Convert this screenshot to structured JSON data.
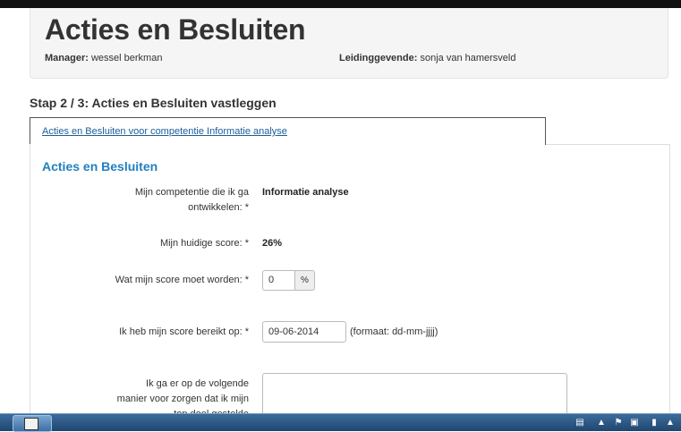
{
  "header": {
    "title": "Acties en Besluiten",
    "manager_label": "Manager:",
    "manager_value": "wessel berkman",
    "leidinggevende_label": "Leidinggevende:",
    "leidinggevende_value": "sonja van hamersveld"
  },
  "step_title": "Stap 2 / 3: Acties en Besluiten vastleggen",
  "tab": {
    "label": "Acties en Besluiten voor competentie Informatie analyse"
  },
  "section_title": "Acties en Besluiten",
  "form": {
    "competentie_label": "Mijn competentie die ik ga ontwikkelen: *",
    "competentie_value": "Informatie analyse",
    "huidige_label": "Mijn huidige score: *",
    "huidige_value": "26%",
    "doel_label": "Wat mijn score moet worden: *",
    "doel_value": "0",
    "doel_addon": "%",
    "datum_label": "Ik heb mijn score bereikt op: *",
    "datum_value": "09-06-2014",
    "datum_hint": "(formaat: dd-mm-jjjj)",
    "manier_label": "Ik ga er op de volgende manier voor zorgen dat ik mijn top doel gestelde"
  },
  "colors": {
    "accent": "#1f7fbf",
    "link": "#1a5e9a",
    "header_bg": "#f5f5f5",
    "taskbar": "#2a5682"
  },
  "taskbar": {
    "app_icon": "document-icon",
    "tray_icons": [
      "printer-icon",
      "flag-icon",
      "network-icon",
      "signal-icon",
      "volume-icon"
    ]
  }
}
